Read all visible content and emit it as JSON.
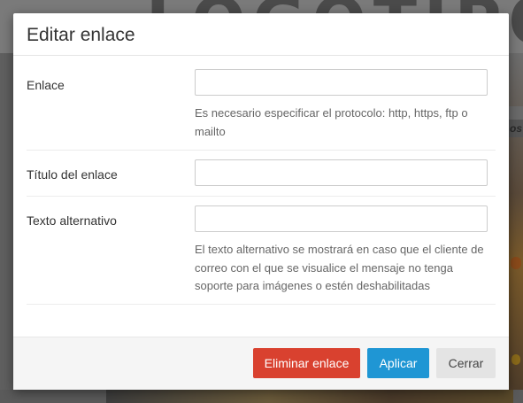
{
  "background": {
    "hero_text": "LOGOTIPO",
    "side_text": "os"
  },
  "dialog": {
    "title": "Editar enlace",
    "fields": [
      {
        "label": "Enlace",
        "value": "",
        "placeholder": "",
        "help": "Es necesario especificar el protocolo: http, https, ftp o mailto"
      },
      {
        "label": "Título del enlace",
        "value": "",
        "placeholder": ""
      },
      {
        "label": "Texto alternativo",
        "value": "",
        "placeholder": "",
        "help": "El texto alternativo se mostrará en caso que el cliente de correo con el que se visualice el mensaje no tenga soporte para imágenes o estén deshabilitadas"
      }
    ],
    "buttons": {
      "remove": "Eliminar enlace",
      "apply": "Aplicar",
      "close": "Cerrar"
    }
  },
  "colors": {
    "remove_button": "#d9412f",
    "apply_button": "#1f96d4",
    "close_button": "#e4e4e4",
    "overlay": "#6b6b6b"
  }
}
